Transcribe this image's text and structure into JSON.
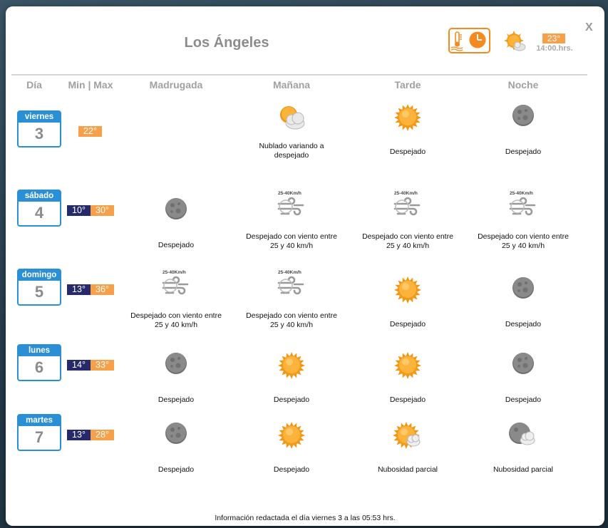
{
  "title": "Los Ángeles",
  "close_label": "X",
  "current": {
    "temp": "23°",
    "time": "14:00.hrs.",
    "icon": "sun-cloud-icon"
  },
  "headers": {
    "day": "Día",
    "minmax": "Min | Max",
    "madrugada": "Madrugada",
    "manana": "Mañana",
    "tarde": "Tarde",
    "noche": "Noche"
  },
  "days": [
    {
      "name": "viernes",
      "num": "3",
      "min": "",
      "max": "22°",
      "periods": [
        null,
        {
          "icon": "partly-cloudy-icon",
          "line1": "Nublado variando a",
          "line2": "despejado"
        },
        {
          "icon": "sun-icon",
          "line1": "Despejado",
          "line2": ""
        },
        {
          "icon": "moon-icon",
          "line1": "Despejado",
          "line2": ""
        }
      ]
    },
    {
      "name": "sábado",
      "num": "4",
      "min": "10°",
      "max": "30°",
      "periods": [
        {
          "icon": "moon-icon",
          "line1": "Despejado",
          "line2": ""
        },
        {
          "icon": "wind-icon",
          "line1": "Despejado con viento entre",
          "line2": "25 y 40 km/h"
        },
        {
          "icon": "wind-icon",
          "line1": "Despejado con viento entre",
          "line2": "25 y 40 km/h"
        },
        {
          "icon": "wind-icon",
          "line1": "Despejado con viento entre",
          "line2": "25 y 40 km/h"
        }
      ]
    },
    {
      "name": "domingo",
      "num": "5",
      "min": "13°",
      "max": "36°",
      "periods": [
        {
          "icon": "wind-icon",
          "line1": "Despejado con viento entre",
          "line2": "25 y 40 km/h"
        },
        {
          "icon": "wind-icon",
          "line1": "Despejado con viento entre",
          "line2": "25 y 40 km/h"
        },
        {
          "icon": "sun-icon",
          "line1": "Despejado",
          "line2": ""
        },
        {
          "icon": "moon-icon",
          "line1": "Despejado",
          "line2": ""
        }
      ]
    },
    {
      "name": "lunes",
      "num": "6",
      "min": "14°",
      "max": "33°",
      "periods": [
        {
          "icon": "moon-icon",
          "line1": "Despejado",
          "line2": ""
        },
        {
          "icon": "sun-icon",
          "line1": "Despejado",
          "line2": ""
        },
        {
          "icon": "sun-icon",
          "line1": "Despejado",
          "line2": ""
        },
        {
          "icon": "moon-icon",
          "line1": "Despejado",
          "line2": ""
        }
      ]
    },
    {
      "name": "martes",
      "num": "7",
      "min": "13°",
      "max": "28°",
      "periods": [
        {
          "icon": "moon-icon",
          "line1": "Despejado",
          "line2": ""
        },
        {
          "icon": "sun-icon",
          "line1": "Despejado",
          "line2": ""
        },
        {
          "icon": "sun-cloud-icon",
          "line1": "Nubosidad parcial",
          "line2": ""
        },
        {
          "icon": "moon-cloud-icon",
          "line1": "Nubosidad parcial",
          "line2": ""
        }
      ]
    }
  ],
  "wind_badge": "25-40Km/h",
  "footnote": "Información redactada el día viernes 3 a las 05:53 hrs.",
  "colors": {
    "accent_blue": "#2b8fd6",
    "min_temp": "#272a6a",
    "max_temp": "#f6a04a",
    "toggle_orange": "#f4891e"
  }
}
